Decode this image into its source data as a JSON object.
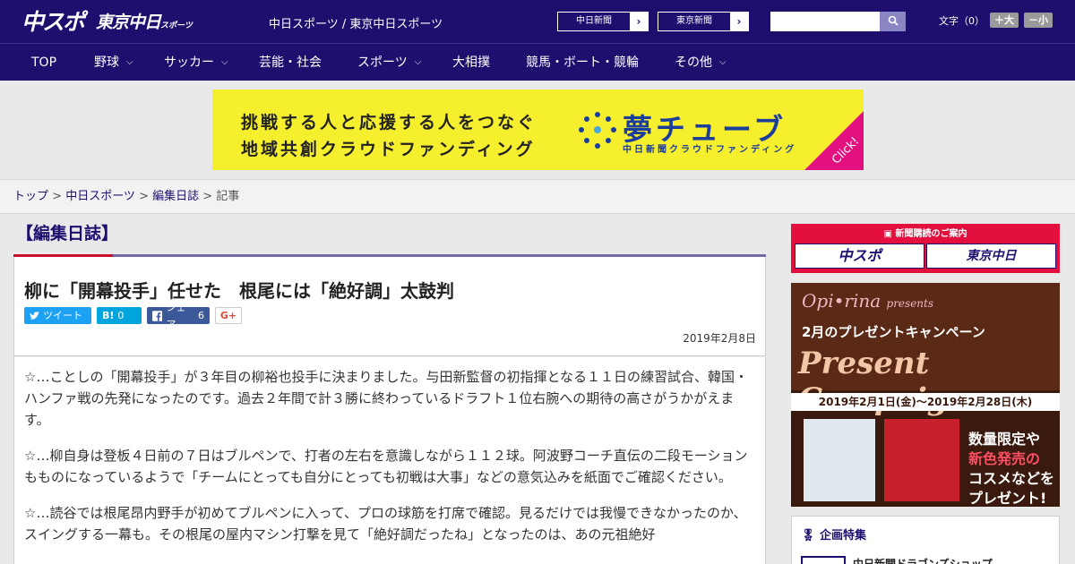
{
  "header": {
    "logo_main": "中スポ",
    "logo_tokyo": "東京中日",
    "logo_tokyo_small": "スポーツ",
    "site_links": "中日スポーツ / 東京中日スポーツ",
    "sites": [
      {
        "label": "中日新聞",
        "arrow": "›"
      },
      {
        "label": "東京新聞",
        "arrow": "›"
      }
    ],
    "search_placeholder": "",
    "fontsize_label": "文字（0）",
    "font_bigger": "＋大",
    "font_smaller": "－小"
  },
  "nav": [
    {
      "label": "TOP",
      "dropdown": ""
    },
    {
      "label": "野球",
      "dropdown": "⌵"
    },
    {
      "label": "サッカー",
      "dropdown": "⌵"
    },
    {
      "label": "芸能・社会",
      "dropdown": ""
    },
    {
      "label": "スポーツ",
      "dropdown": "⌵"
    },
    {
      "label": "大相撲",
      "dropdown": ""
    },
    {
      "label": "競馬・ボート・競輪",
      "dropdown": ""
    },
    {
      "label": "その他",
      "dropdown": "⌵"
    }
  ],
  "banner": {
    "line1": "挑戦する人と応援する人をつなぐ",
    "line2": "地域共創クラウドファンディング",
    "brand": "夢チューブ",
    "sub": "中日新聞クラウドファンディング",
    "click": "Click!"
  },
  "breadcrumb": {
    "top": "トップ",
    "section": "中日スポーツ",
    "category": "編集日誌",
    "current": "記事",
    "sep": " > "
  },
  "article": {
    "category": "【編集日誌】",
    "title": "柳に「開幕投手」任せた　根尾には「絶好調」太鼓判",
    "share": {
      "tweet": "ツイート",
      "hatena": "B!",
      "hatena_count": "0",
      "facebook": "シェア",
      "facebook_count": "6",
      "gplus": "G+"
    },
    "date": "2019年2月8日",
    "paragraphs": [
      "☆…ことしの「開幕投手」が３年目の柳裕也投手に決まりました。与田新監督の初指揮となる１１日の練習試合、韓国・ハンファ戦の先発になったのです。過去２年間で計３勝に終わっているドラフト１位右腕への期待の高さがうかがえます。",
      "☆…柳自身は登板４日前の７日はブルペンで、打者の左右を意識しながら１１２球。阿波野コーチ直伝の二段モーションもものになっているようで「チームにとっても自分にとっても初戦は大事」などの意気込みを紙面でご確認ください。",
      "☆…読谷では根尾昂内野手が初めてブルペンに入って、プロの球筋を打席で確認。見るだけでは我慢できなかったのか、スイングする一幕も。その根尾の屋内マシン打撃を見て「絶好調だったね」となったのは、あの元祖絶好"
    ]
  },
  "sidebar": {
    "subscribe_label": "新聞購読のご案内",
    "sub_logo1": "中スポ",
    "sub_logo2": "東京中日",
    "ad": {
      "brand": "Opi•rina",
      "presents": "presents",
      "campaign": "2月のプレゼントキャンペーン",
      "headline": "Present Campaign",
      "period": "2019年2月1日(金)～2019年2月28日(木)",
      "promo1": "数量限定や",
      "promo2": "新色発売の",
      "promo3": "コスメなどを",
      "promo4": "プレゼント!"
    },
    "feature_title": "企画特集",
    "feature_item": "中日新聞ドラゴンズショップ"
  },
  "colors": {
    "brand_navy": "#1e0f6e",
    "accent_red": "#c8102e",
    "banner_yellow": "#f6ef2e"
  }
}
